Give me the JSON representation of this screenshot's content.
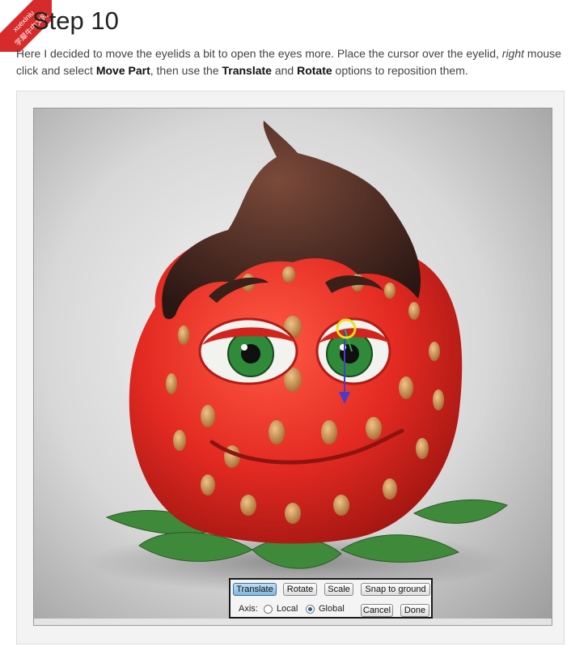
{
  "watermark": {
    "line1": "xuexiniu",
    "line2": "学犀牛中文网"
  },
  "heading": "Step 10",
  "intro": {
    "p1": "Here I decided to move the eyelids a bit to open the eyes more. Place the cursor over the eyelid, ",
    "right": "right",
    "p2": " mouse click and select ",
    "move_part": "Move Part",
    "p3": ", then use the ",
    "translate": "Translate",
    "p4": " and ",
    "rotate": "Rotate",
    "p5": " options to reposition them."
  },
  "toolbar": {
    "translate": "Translate",
    "rotate": "Rotate",
    "scale": "Scale",
    "snap": "Snap to ground",
    "axis_label": "Axis:",
    "local": "Local",
    "global": "Global",
    "cancel": "Cancel",
    "done": "Done",
    "active_tool": "Translate",
    "selected_axis": "Global"
  },
  "colors": {
    "strawberry": "#e32a22",
    "chocolate": "#4a2a22",
    "leaf": "#3f8a3a",
    "iris": "#2f8a3a",
    "gizmo_axis": "#4a3cc8",
    "gizmo_handle": "#e8e020"
  }
}
